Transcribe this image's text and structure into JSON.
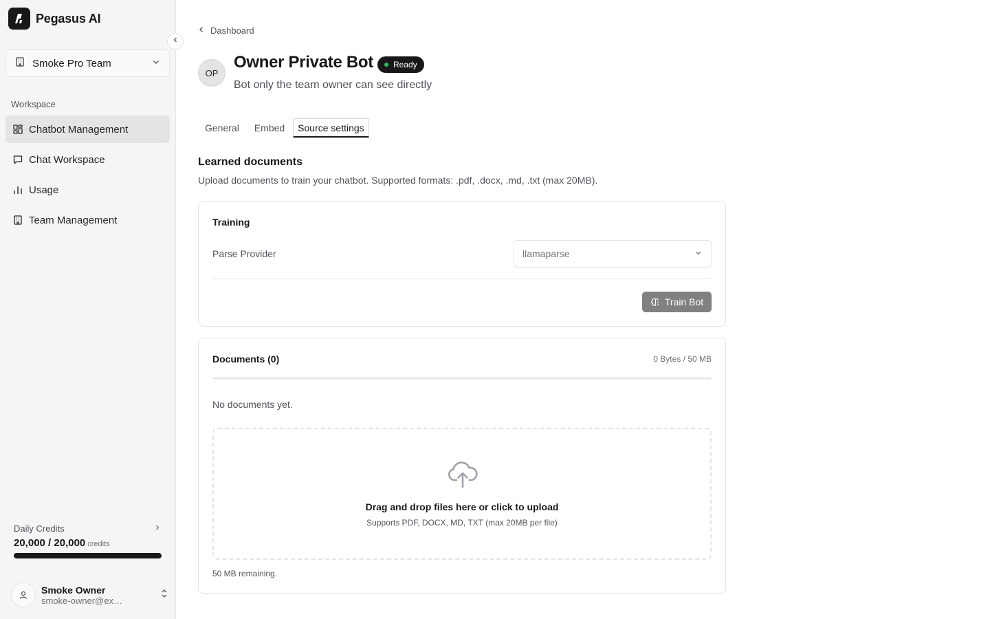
{
  "brand": {
    "name": "Pegasus AI"
  },
  "team_switcher": {
    "label": "Smoke Pro Team"
  },
  "sidebar": {
    "section_label": "Workspace",
    "items": [
      {
        "label": "Chatbot Management",
        "icon": "dashboard-grid-icon",
        "active": true
      },
      {
        "label": "Chat Workspace",
        "icon": "message-square-icon",
        "active": false
      },
      {
        "label": "Usage",
        "icon": "bar-chart-icon",
        "active": false
      },
      {
        "label": "Team Management",
        "icon": "building-icon",
        "active": false
      }
    ]
  },
  "credits": {
    "title": "Daily Credits",
    "value": "20,000 / 20,000",
    "unit": "credits",
    "fill_fraction": 1.0
  },
  "user": {
    "name": "Smoke Owner",
    "email": "smoke-owner@example.com"
  },
  "breadcrumb": {
    "label": "Dashboard"
  },
  "bot": {
    "initials": "OP",
    "title": "Owner Private Bot",
    "status": "Ready",
    "description": "Bot only the team owner can see directly"
  },
  "tabs": [
    {
      "label": "General",
      "active": false
    },
    {
      "label": "Embed",
      "active": false
    },
    {
      "label": "Source settings",
      "active": true
    }
  ],
  "learned_docs": {
    "title": "Learned documents",
    "description": "Upload documents to train your chatbot. Supported formats: .pdf, .docx, .md, .txt (max 20MB)."
  },
  "training": {
    "title": "Training",
    "parse_provider_label": "Parse Provider",
    "parse_provider_value": "llamaparse",
    "train_button": "Train Bot"
  },
  "documents": {
    "title": "Documents (0)",
    "size": "0 Bytes / 50 MB",
    "usage_fraction": 0.0,
    "empty_text": "No documents yet.",
    "dropzone_title": "Drag and drop files here or click to upload",
    "dropzone_subtitle": "Supports PDF, DOCX, MD, TXT (max 20MB per file)",
    "remaining": "50 MB remaining."
  },
  "colors": {
    "accent": "#18181b",
    "status_dot": "#22c55e",
    "sidebar_bg": "#f5f5f5",
    "active_nav_bg": "#e4e4e4"
  }
}
